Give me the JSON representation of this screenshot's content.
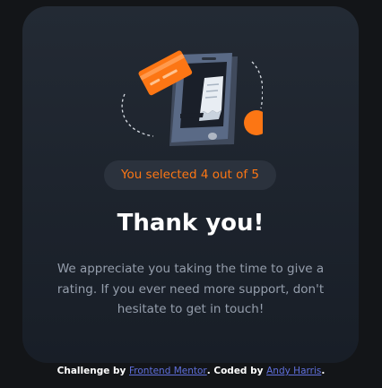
{
  "badge": {
    "text": "You selected 4 out of 5"
  },
  "title": "Thank you!",
  "message": "We appreciate you taking the time to give a rating. If you ever need more support, don't hesitate to get in touch!",
  "footer": {
    "challenge_by": "Challenge by ",
    "frontend_mentor": "Frontend Mentor",
    "coded_by": ". Coded by ",
    "author": "Andy Harris",
    "end": "."
  },
  "colors": {
    "accent": "#fc7614",
    "title": "#ffffff",
    "body_text": "#959eac",
    "card": "#1f252e",
    "link": "#5f6fdc"
  },
  "illustration": {
    "icon": "phone-payment-illustration"
  }
}
